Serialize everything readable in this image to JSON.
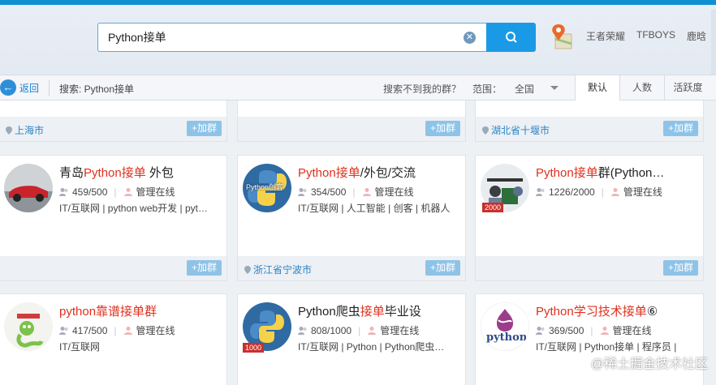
{
  "search": {
    "value": "Python接单",
    "clear_icon": "✕"
  },
  "hot_links": [
    "王者荣耀",
    "TFBOYS",
    "鹿晗"
  ],
  "toolbar": {
    "back_label": "返回",
    "search_label": "搜索: Python接单",
    "notfound_label": "搜索不到我的群？",
    "range_label": "范围：",
    "range_value": "全国",
    "sort_tabs": [
      "默认",
      "人数",
      "活跃度"
    ]
  },
  "join_label": "+加群",
  "top_row": [
    {
      "location": "上海市"
    },
    {
      "location": ""
    },
    {
      "location": "湖北省十堰市"
    }
  ],
  "groups": [
    {
      "name_pre": "青岛",
      "name_hl": "Python接单",
      "name_post": " 外包",
      "members": "459/500",
      "admin": "管理在线",
      "tags": "IT/互联网 | python web开发 | pyt…",
      "location": ""
    },
    {
      "name_pre": "",
      "name_hl": "Python接单",
      "name_post": "/外包/交流",
      "members": "354/500",
      "admin": "管理在线",
      "tags": "IT/互联网 | 人工智能 | 创客 | 机器人",
      "location": "浙江省宁波市",
      "avatar_text": "Python创客"
    },
    {
      "name_pre": "",
      "name_hl": "Python接单",
      "name_post": "群(Python…",
      "members": "1226/2000",
      "admin": "管理在线",
      "tags": "",
      "location": "",
      "avatar_badge": "2000"
    },
    {
      "name_pre": "python靠谱",
      "name_hl": "接单",
      "name_post": "群",
      "members": "417/500",
      "admin": "管理在线",
      "tags": "IT/互联网",
      "location": ""
    },
    {
      "name_pre": "Python爬虫",
      "name_hl": "接单",
      "name_post": "毕业设",
      "members": "808/1000",
      "admin": "管理在线",
      "tags": "IT/互联网 | Python | Python爬虫…",
      "location": "",
      "avatar_badge": "1000"
    },
    {
      "name_pre": "Python学习技术",
      "name_hl": "接单",
      "name_post": "⑥",
      "members": "369/500",
      "admin": "管理在线",
      "tags": "IT/互联网 | Python接单 | 程序员 |",
      "location": "",
      "avatar_text": "python"
    }
  ],
  "watermark": "@稀土掘金技术社区",
  "colors": {
    "accent": "#1a9ae6",
    "highlight": "#e0301e",
    "join_bg": "#8ec3e8",
    "link": "#2a84c6"
  }
}
